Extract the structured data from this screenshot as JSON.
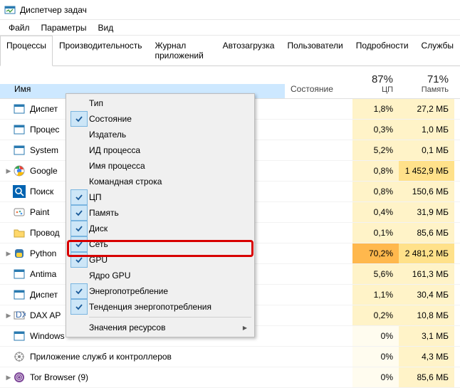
{
  "window": {
    "title": "Диспетчер задач"
  },
  "menubar": {
    "file": "Файл",
    "options": "Параметры",
    "view": "Вид"
  },
  "tabs": {
    "items": [
      "Процессы",
      "Производительность",
      "Журнал приложений",
      "Автозагрузка",
      "Пользователи",
      "Подробности",
      "Службы"
    ],
    "active": 0
  },
  "columns": {
    "name": "Имя",
    "state": "Состояние",
    "cpu": {
      "pct": "87%",
      "label": "ЦП"
    },
    "mem": {
      "pct": "71%",
      "label": "Память"
    }
  },
  "processes": [
    {
      "icon": "task",
      "name": "Диспет",
      "cpu": "1,8%",
      "mem": "27,2 МБ",
      "cpucls": "cell-l",
      "memcls": "cell-l"
    },
    {
      "icon": "task",
      "name": "Процес",
      "cpu": "0,3%",
      "mem": "1,0 МБ",
      "cpucls": "cell-l",
      "memcls": "cell-l"
    },
    {
      "icon": "task",
      "name": "System",
      "cpu": "5,2%",
      "mem": "0,1 МБ",
      "cpucls": "cell-l",
      "memcls": "cell-l"
    },
    {
      "icon": "chrome",
      "name": "Google",
      "expand": true,
      "cpu": "0,8%",
      "mem": "1 452,9 МБ",
      "cpucls": "cell-l",
      "memcls": "cell-m"
    },
    {
      "icon": "search",
      "name": "Поиск",
      "cpu": "0,8%",
      "mem": "150,6 МБ",
      "cpucls": "cell-l",
      "memcls": "cell-l"
    },
    {
      "icon": "paint",
      "name": "Paint",
      "cpu": "0,4%",
      "mem": "31,9 МБ",
      "cpucls": "cell-l",
      "memcls": "cell-l"
    },
    {
      "icon": "folder",
      "name": "Провод",
      "cpu": "0,1%",
      "mem": "85,6 МБ",
      "cpucls": "cell-l",
      "memcls": "cell-l"
    },
    {
      "icon": "python",
      "name": "Python",
      "expand": true,
      "cpu": "70,2%",
      "mem": "2 481,2 МБ",
      "cpucls": "cell-h",
      "memcls": "cell-m"
    },
    {
      "icon": "task",
      "name": "Antima",
      "cpu": "5,6%",
      "mem": "161,3 МБ",
      "cpucls": "cell-l",
      "memcls": "cell-l"
    },
    {
      "icon": "task",
      "name": "Диспет",
      "cpu": "1,1%",
      "mem": "30,4 МБ",
      "cpucls": "cell-l",
      "memcls": "cell-l"
    },
    {
      "icon": "dax",
      "name": "DAX AP",
      "expand": true,
      "cpu": "0,2%",
      "mem": "10,8 МБ",
      "cpucls": "cell-l",
      "memcls": "cell-l"
    },
    {
      "icon": "task",
      "name_full": "Windows",
      "cpu": "0%",
      "mem": "3,1 МБ",
      "cpucls": "cell-z",
      "memcls": "cell-l"
    },
    {
      "icon": "svc",
      "name_full": "Приложение служб и контроллеров",
      "cpu": "0%",
      "mem": "4,3 МБ",
      "cpucls": "cell-z",
      "memcls": "cell-l"
    },
    {
      "icon": "tor",
      "name_full": "Tor Browser (9)",
      "expand": true,
      "cpu": "0%",
      "mem": "85,6 МБ",
      "cpucls": "cell-z",
      "memcls": "cell-l"
    }
  ],
  "context_menu": {
    "items": [
      {
        "label": "Тип",
        "checked": false
      },
      {
        "label": "Состояние",
        "checked": true
      },
      {
        "label": "Издатель",
        "checked": false
      },
      {
        "label": "ИД процесса",
        "checked": false
      },
      {
        "label": "Имя процесса",
        "checked": false
      },
      {
        "label": "Командная строка",
        "checked": false
      },
      {
        "label": "ЦП",
        "checked": true
      },
      {
        "label": "Память",
        "checked": true
      },
      {
        "label": "Диск",
        "checked": true
      },
      {
        "label": "Сеть",
        "checked": true
      },
      {
        "label": "GPU",
        "checked": true,
        "highlight": true
      },
      {
        "label": "Ядро GPU",
        "checked": false
      },
      {
        "label": "Энергопотребление",
        "checked": true
      },
      {
        "label": "Тенденция энергопотребления",
        "checked": true
      },
      {
        "sep": true
      },
      {
        "label": "Значения ресурсов",
        "submenu": true
      }
    ]
  }
}
